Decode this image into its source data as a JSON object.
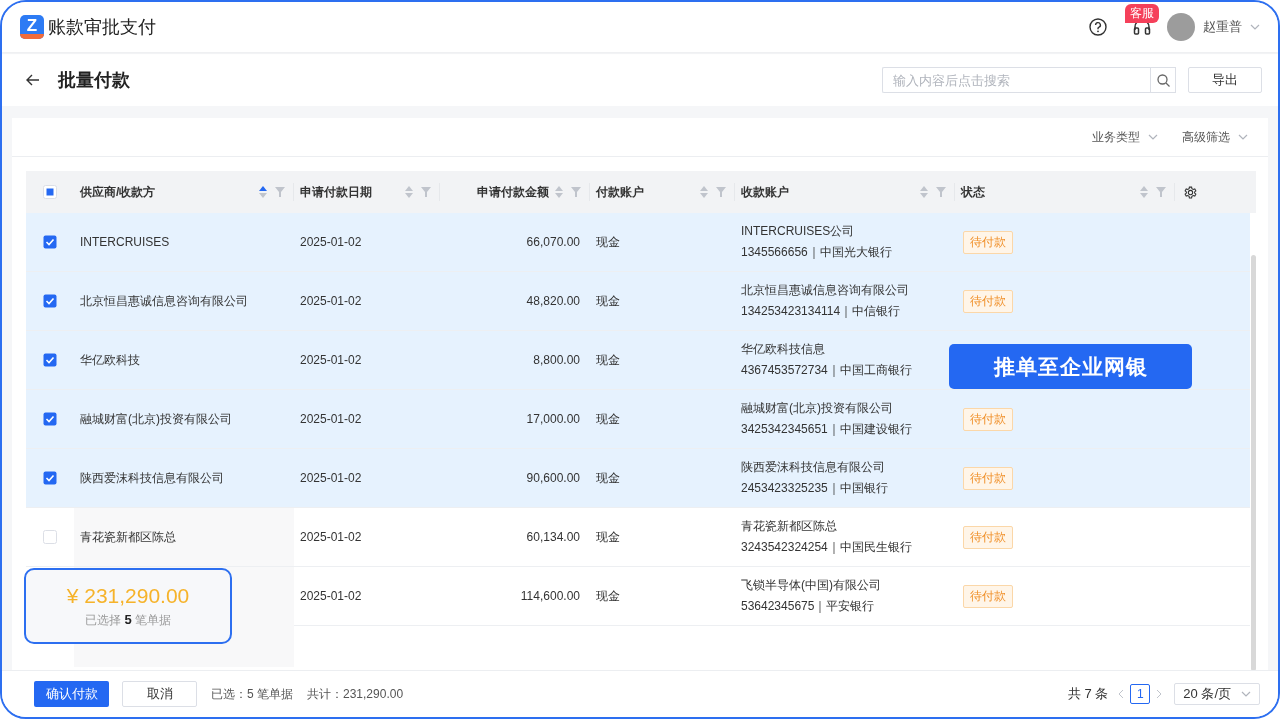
{
  "app": {
    "logo_mark": "Z",
    "title": "账款审批支付",
    "support_badge": "客服",
    "user": "赵重普"
  },
  "page": {
    "title": "批量付款",
    "search": {
      "placeholder": "输入内容后点击搜索"
    },
    "export": "导出"
  },
  "filters": [
    "业务类型",
    "高级筛选"
  ],
  "table": {
    "header_partially_checked": true,
    "columns": [
      {
        "label": "供应商/收款方",
        "sorted_ascending": true
      },
      {
        "label": "申请付款日期",
        "sorted_ascending": false
      },
      {
        "label": "申请付款金额",
        "sorted_ascending": false
      },
      {
        "label": "付款账户",
        "sorted_ascending": false
      },
      {
        "label": "收款账户",
        "sorted_ascending": false
      },
      {
        "label": "状态",
        "sorted_ascending": false
      }
    ],
    "rows": [
      {
        "selected": true,
        "supplier": "INTERCRUISES",
        "date": "2025-01-02",
        "amount": "66,070.00",
        "pay_account": "现金",
        "payee": "INTERCRUISES公司",
        "payee_account": "1345566656｜中国光大银行",
        "status": "待付款"
      },
      {
        "selected": true,
        "supplier": "北京恒昌惠诚信息咨询有限公司",
        "date": "2025-01-02",
        "amount": "48,820.00",
        "pay_account": "现金",
        "payee": "北京恒昌惠诚信息咨询有限公司",
        "payee_account": "134253423134114｜中信银行",
        "status": "待付款"
      },
      {
        "selected": true,
        "supplier": "华亿欧科技",
        "date": "2025-01-02",
        "amount": "8,800.00",
        "pay_account": "现金",
        "payee": "华亿欧科技信息",
        "payee_account": "4367453572734｜中国工商银行"
      },
      {
        "selected": true,
        "supplier": "融城财富(北京)投资有限公司",
        "date": "2025-01-02",
        "amount": "17,000.00",
        "pay_account": "现金",
        "payee": "融城财富(北京)投资有限公司",
        "payee_account": "3425342345651｜中国建设银行",
        "status": "待付款"
      },
      {
        "selected": true,
        "supplier": "陕西爱沫科技信息有限公司",
        "date": "2025-01-02",
        "amount": "90,600.00",
        "pay_account": "现金",
        "payee": "陕西爱沫科技信息有限公司",
        "payee_account": "2453423325235｜中国银行",
        "status": "待付款"
      },
      {
        "selected": false,
        "supplier": "青花瓷新都区陈总",
        "date": "2025-01-02",
        "amount": "60,134.00",
        "pay_account": "现金",
        "payee": "青花瓷新都区陈总",
        "payee_account": "3243542324254｜中国民生银行",
        "status": "待付款"
      },
      {
        "selected": false,
        "date": "2025-01-02",
        "amount": "114,600.00",
        "pay_account": "现金",
        "payee": "飞锁半导体(中国)有限公司",
        "payee_account": "53642345675｜平安银行",
        "status": "待付款"
      }
    ]
  },
  "summary_popup": {
    "total": "¥ 231,290.00",
    "caption": "已选择 **5** 笔单据"
  },
  "callout": "推单至企业网银",
  "footer": {
    "confirm": "确认付款",
    "cancel": "取消",
    "selected": "已选：5 笔单据",
    "total": "共计：231,290.00",
    "pagination": {
      "count": "共 7 条",
      "pages": [
        {
          "label": "1",
          "selected": true
        }
      ],
      "page_size": "20 条/页"
    }
  }
}
